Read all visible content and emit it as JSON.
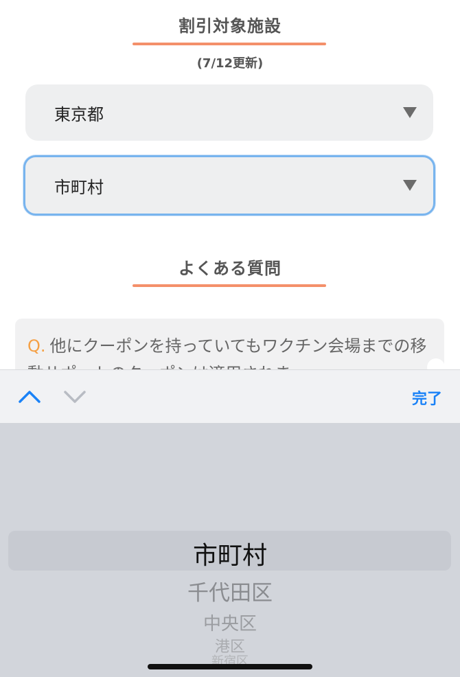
{
  "sections": {
    "facilities_title": "割引対象施設",
    "updated_note": "(7/12更新)",
    "faq_title": "よくある質問"
  },
  "selects": {
    "prefecture": {
      "value": "東京都"
    },
    "municipality": {
      "value": "市町村"
    }
  },
  "faq": {
    "items": [
      {
        "prefix": "Q.",
        "question": "他にクーポンを持っていてもワクチン会場までの移動サポートのクーポンは適用されま…"
      }
    ]
  },
  "keyboard_accessory": {
    "prev_icon": "chevron-up-icon",
    "next_icon": "chevron-down-icon",
    "done_label": "完了",
    "accent_color": "#1a82f7"
  },
  "picker": {
    "options": [
      "市町村",
      "千代田区",
      "中央区",
      "港区",
      "新宿区"
    ],
    "selected": "市町村"
  },
  "colors": {
    "underline": "#f4906a",
    "focus_border": "#78b4ee",
    "faq_q": "#f5a045"
  }
}
